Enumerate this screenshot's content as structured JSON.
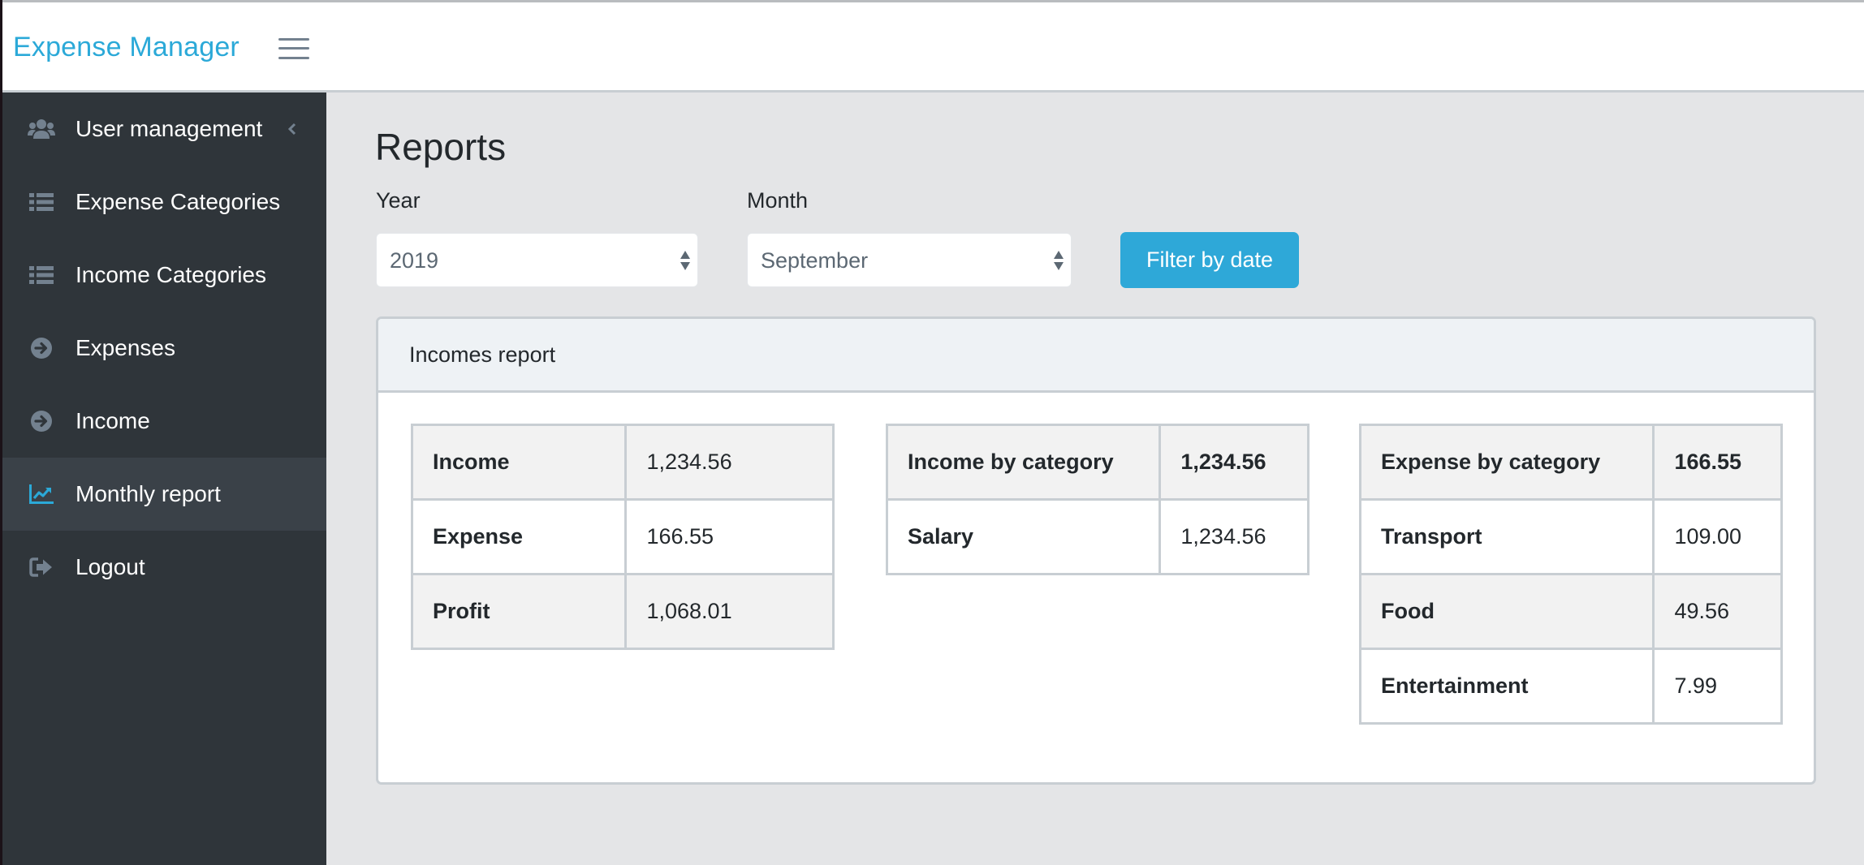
{
  "app": {
    "brand": "Expense Manager",
    "brand_color": "#2ba9d8",
    "menu_toggle_icon": "hamburger-icon"
  },
  "sidebar": {
    "items": [
      {
        "label": "User management",
        "icon": "users-icon",
        "has_submenu": true,
        "active": false
      },
      {
        "label": "Expense Categories",
        "icon": "list-icon",
        "active": false
      },
      {
        "label": "Income Categories",
        "icon": "list-icon",
        "active": false
      },
      {
        "label": "Expenses",
        "icon": "arrow-circle-right-icon",
        "active": false
      },
      {
        "label": "Income",
        "icon": "arrow-circle-right-icon",
        "active": false
      },
      {
        "label": "Monthly report",
        "icon": "line-chart-icon",
        "active": true
      },
      {
        "label": "Logout",
        "icon": "sign-out-icon",
        "active": false
      }
    ],
    "active_icon_color": "#2ba9d8"
  },
  "page": {
    "title": "Reports",
    "filters": {
      "year_label": "Year",
      "year_value": "2019",
      "month_label": "Month",
      "month_value": "September",
      "submit_label": "Filter by date",
      "submit_color": "#2ea8d8"
    }
  },
  "report": {
    "title": "Incomes report",
    "summary": [
      {
        "key": "Income",
        "value": "1,234.56"
      },
      {
        "key": "Expense",
        "value": "166.55"
      },
      {
        "key": "Profit",
        "value": "1,068.01"
      }
    ],
    "income_by_category": {
      "header": "Income by category",
      "total": "1,234.56",
      "rows": [
        {
          "key": "Salary",
          "value": "1,234.56"
        }
      ]
    },
    "expense_by_category": {
      "header": "Expense by category",
      "total": "166.55",
      "rows": [
        {
          "key": "Transport",
          "value": "109.00"
        },
        {
          "key": "Food",
          "value": "49.56"
        },
        {
          "key": "Entertainment",
          "value": "7.99"
        }
      ]
    }
  }
}
